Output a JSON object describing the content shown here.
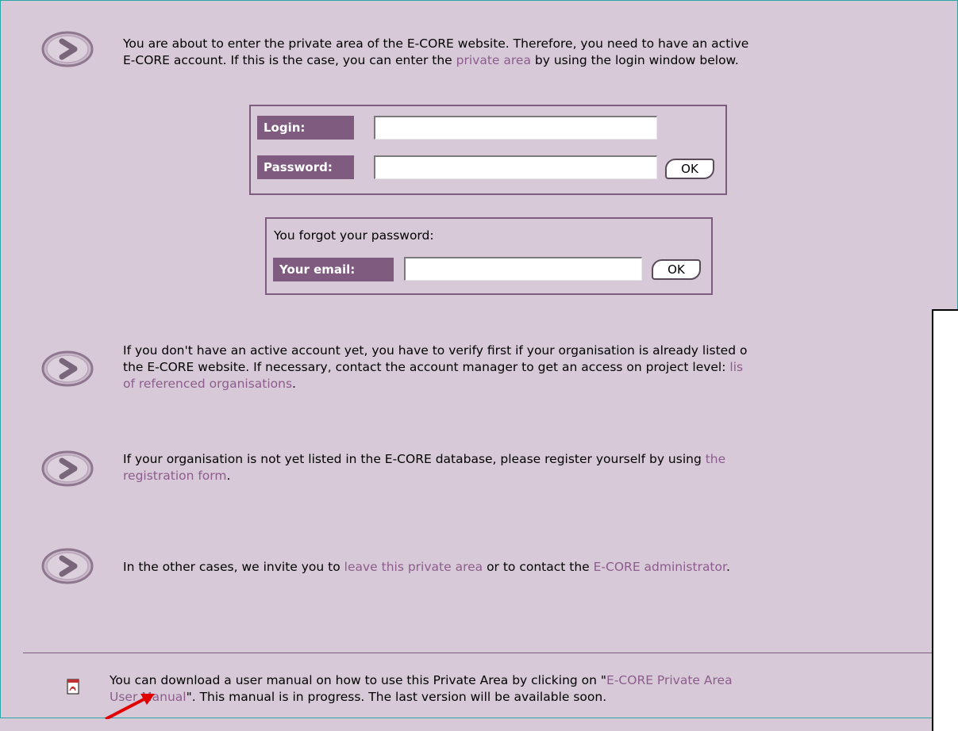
{
  "intro": {
    "line1": "You are about to enter the private area of the E-CORE website. Therefore, you need to have an active",
    "line2_before": "E-CORE account. If this is the case, you can enter the ",
    "line2_link": "private area",
    "line2_after": " by using the login window below."
  },
  "login_form": {
    "login_label": "Login:",
    "password_label": "Password:",
    "login_value": "",
    "password_value": "",
    "ok_label": "OK"
  },
  "forgot_form": {
    "title": "You forgot your password:",
    "email_label": "Your email:",
    "email_value": "",
    "ok_label": "OK"
  },
  "no_account": {
    "line1": "If you don't have an active account yet, you have to verify first if your organisation is already listed o",
    "line2": "the E-CORE website. If necessary, contact the account manager to get an access on project level: ",
    "link_part1": "lis",
    "link_part2": "of referenced organisations",
    "after": "."
  },
  "not_listed": {
    "line1_before": "If your organisation is not yet listed in the E-CORE database, please register yourself by using ",
    "link_part1": "the",
    "link_part2": "registration form",
    "after": "."
  },
  "other": {
    "before": "In the other cases, we invite you to ",
    "link1": "leave this private area",
    "middle": " or to contact the ",
    "link2": "E-CORE administrator",
    "after": "."
  },
  "manual": {
    "line1_before": "You can download a user manual on how to use this Private Area by clicking on \"",
    "link_part1": "E-CORE Private Area",
    "link_part2": "User Manual",
    "line2_after": "\". This manual is in progress. The last version will be available soon.",
    "icon": "pdf-icon"
  },
  "colors": {
    "background": "#d7c9d7",
    "accent": "#7f5b7f",
    "link": "#8c5d8c"
  }
}
